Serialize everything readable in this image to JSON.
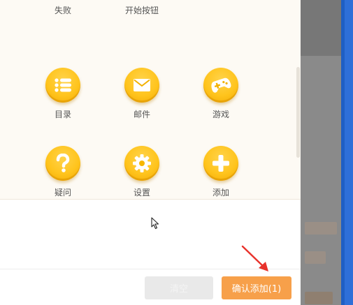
{
  "dialog": {
    "top_row": [
      {
        "label": "失败"
      },
      {
        "label": "开始按钮"
      }
    ],
    "icons": [
      {
        "label": "目录",
        "icon": "list-icon"
      },
      {
        "label": "邮件",
        "icon": "mail-icon"
      },
      {
        "label": "游戏",
        "icon": "gamepad-icon"
      },
      {
        "label": "疑问",
        "icon": "question-icon"
      },
      {
        "label": "设置",
        "icon": "gear-icon"
      },
      {
        "label": "添加",
        "icon": "plus-icon"
      }
    ],
    "buttons": {
      "clear_label": "清空",
      "confirm_label": "确认添加(1)"
    }
  },
  "colors": {
    "icon_yellow": "#ffc41d",
    "confirm_orange": "#f7a04a",
    "annotation_red": "#e8322b",
    "side_blue": "#2e6fd8"
  }
}
